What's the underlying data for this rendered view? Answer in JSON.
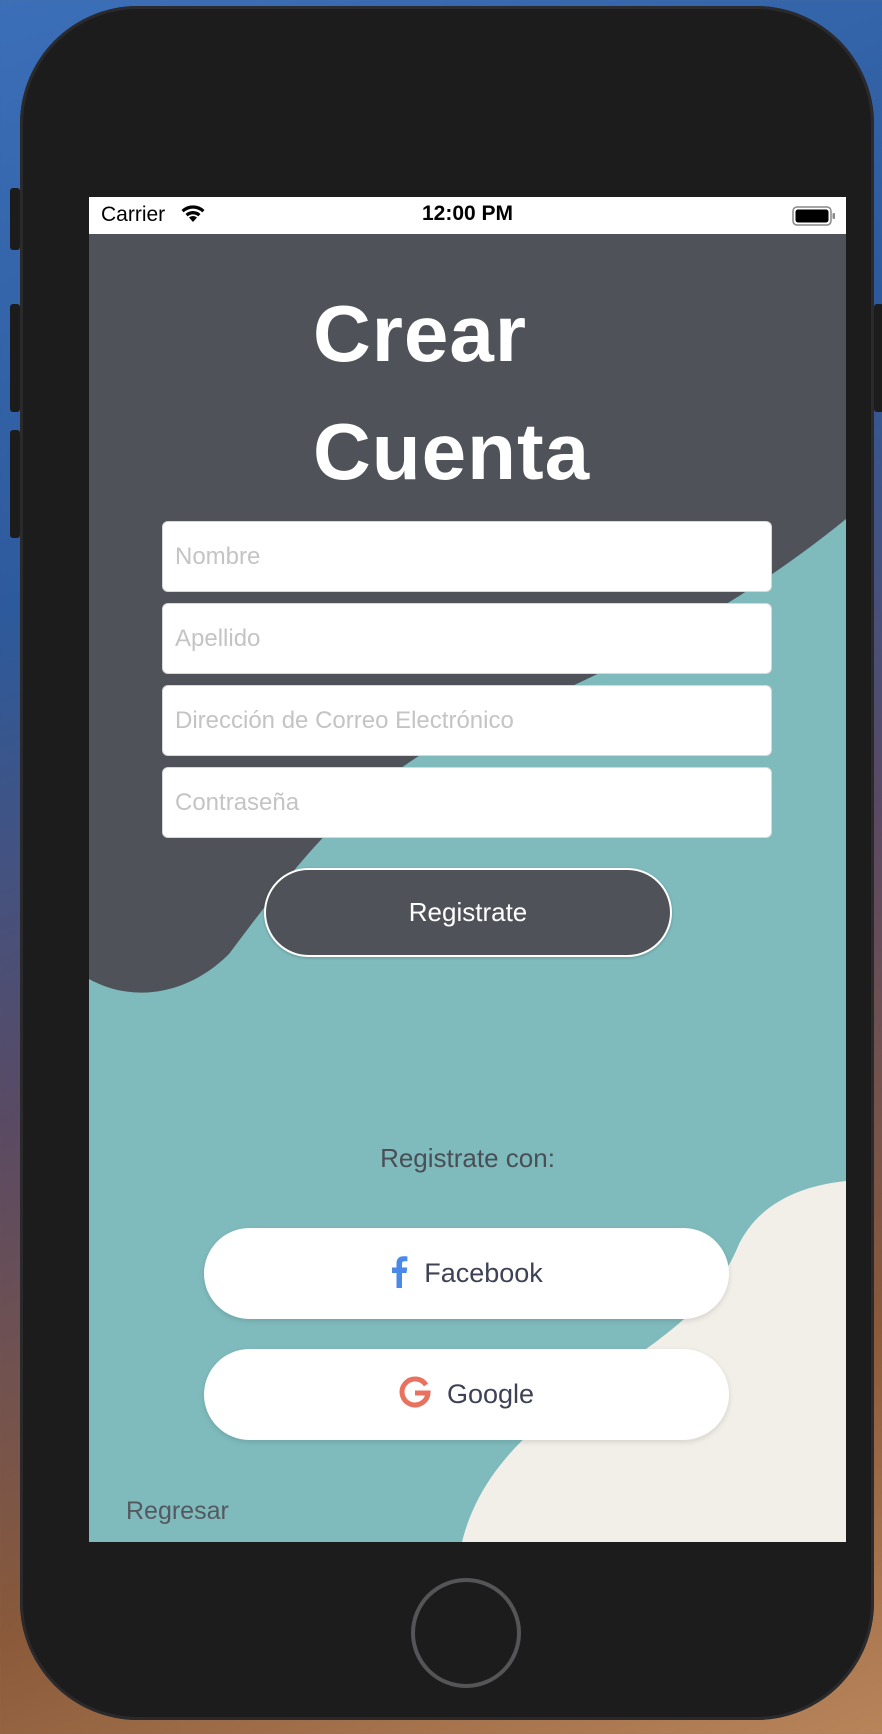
{
  "status_bar": {
    "carrier": "Carrier",
    "time": "12:00 PM"
  },
  "title": {
    "line1": "Crear",
    "line2": "Cuenta"
  },
  "form": {
    "first_name_placeholder": "Nombre",
    "last_name_placeholder": "Apellido",
    "email_placeholder": "Dirección de Correo Electrónico",
    "password_placeholder": "Contraseña"
  },
  "register_button": "Registrate",
  "register_with_label": "Registrate con:",
  "social": {
    "facebook": {
      "label": "Facebook",
      "icon": "facebook-icon",
      "color": "#4a89e8"
    },
    "google": {
      "label": "Google",
      "icon": "google-icon",
      "color": "#e8725f"
    }
  },
  "back_link": "Regresar",
  "colors": {
    "dark": "#4f5359",
    "teal": "#7fbbbd",
    "cream": "#f2eee8",
    "white": "#ffffff"
  }
}
